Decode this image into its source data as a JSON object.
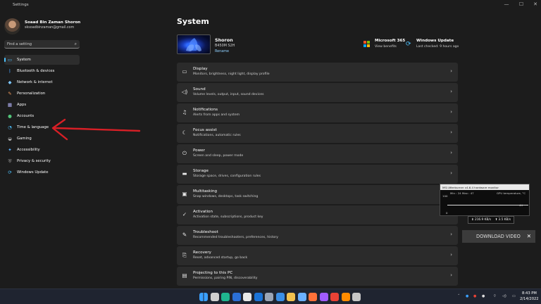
{
  "window": {
    "title": "Settings",
    "controls": {
      "minimize": "—",
      "maximize": "☐",
      "close": "✕"
    }
  },
  "user": {
    "name": "Soaad Bin Zaman Shoron",
    "email": "sksoadbinzaman@gmail.com"
  },
  "search": {
    "placeholder": "Find a setting",
    "icon": "search-icon"
  },
  "sidebar": {
    "items": [
      {
        "label": "System",
        "icon": "system-icon",
        "color": "#4cc2ff",
        "active": true
      },
      {
        "label": "Bluetooth & devices",
        "icon": "bluetooth-icon",
        "color": "#4aa3ff"
      },
      {
        "label": "Network & internet",
        "icon": "wifi-icon",
        "color": "#7ec8ff"
      },
      {
        "label": "Personalization",
        "icon": "brush-icon",
        "color": "#f29b5c"
      },
      {
        "label": "Apps",
        "icon": "apps-icon",
        "color": "#b8b8ff"
      },
      {
        "label": "Accounts",
        "icon": "accounts-icon",
        "color": "#52c47a"
      },
      {
        "label": "Time & language",
        "icon": "time-language-icon",
        "color": "#4cc2ff"
      },
      {
        "label": "Gaming",
        "icon": "gaming-icon",
        "color": "#b0b0b0"
      },
      {
        "label": "Accessibility",
        "icon": "accessibility-icon",
        "color": "#5ab0ff"
      },
      {
        "label": "Privacy & security",
        "icon": "shield-icon",
        "color": "#a0a0a0"
      },
      {
        "label": "Windows Update",
        "icon": "windows-update-icon",
        "color": "#4cc2ff"
      }
    ]
  },
  "main": {
    "title": "System",
    "device": {
      "name": "Shoron",
      "model": "B450M S2H",
      "rename": "Rename"
    },
    "microsoft365": {
      "title": "Microsoft 365",
      "subtitle": "View benefits",
      "logo_colors": [
        "#f35325",
        "#81bc06",
        "#05a6f0",
        "#ffba08"
      ]
    },
    "windows_update": {
      "title": "Windows Update",
      "subtitle": "Last checked: 9 hours ago"
    },
    "settings": [
      {
        "title": "Display",
        "subtitle": "Monitors, brightness, night light, display profile",
        "icon": "display-icon"
      },
      {
        "title": "Sound",
        "subtitle": "Volume levels, output, input, sound devices",
        "icon": "speaker-icon"
      },
      {
        "title": "Notifications",
        "subtitle": "Alerts from apps and system",
        "icon": "bell-icon"
      },
      {
        "title": "Focus assist",
        "subtitle": "Notifications, automatic rules",
        "icon": "moon-icon"
      },
      {
        "title": "Power",
        "subtitle": "Screen and sleep, power mode",
        "icon": "power-icon"
      },
      {
        "title": "Storage",
        "subtitle": "Storage space, drives, configuration rules",
        "icon": "storage-icon"
      },
      {
        "title": "Multitasking",
        "subtitle": "Snap windows, desktops, task switching",
        "icon": "multitasking-icon"
      },
      {
        "title": "Activation",
        "subtitle": "Activation state, subscriptions, product key",
        "icon": "checkmark-circle-icon"
      },
      {
        "title": "Troubleshoot",
        "subtitle": "Recommended troubleshooters, preferences, history",
        "icon": "wrench-icon"
      },
      {
        "title": "Recovery",
        "subtitle": "Reset, advanced startup, go back",
        "icon": "recovery-icon"
      },
      {
        "title": "Projecting to this PC",
        "subtitle": "Permissions, pairing PIN, discoverability",
        "icon": "projector-icon"
      }
    ]
  },
  "overlay": {
    "afterburner_title": "MSI Afterburner v4.6.4 hardware monitor",
    "stats": "Min : 24  Max : 47",
    "gpu_label": "GPU temperature, °C",
    "tick_top": "100",
    "tick_bottom": "0",
    "current_value": "44",
    "net_down": "⬇ 216.9 KB/s",
    "net_up": "⬆ 3.5 KB/s",
    "download_video": "DOWNLOAD VIDEO",
    "download_close": "✕"
  },
  "taskbar": {
    "icons": [
      {
        "name": "start-icon",
        "color": "#3aa0ff"
      },
      {
        "name": "search-taskbar-icon",
        "color": "#d0d0d0"
      },
      {
        "name": "edge-icon",
        "color": "#1fb58f"
      },
      {
        "name": "word-icon",
        "color": "#2b6fd6"
      },
      {
        "name": "calendar-icon",
        "color": "#e8e8e8"
      },
      {
        "name": "outlook-icon",
        "color": "#1a73d8"
      },
      {
        "name": "settings-icon",
        "color": "#9aa4b5"
      },
      {
        "name": "store-icon",
        "color": "#3a8ee6"
      },
      {
        "name": "file-explorer-icon",
        "color": "#f2c14e"
      },
      {
        "name": "photos-icon",
        "color": "#6ab0ff"
      },
      {
        "name": "firefox-icon",
        "color": "#ff7139"
      },
      {
        "name": "messenger-icon",
        "color": "#a05cff"
      },
      {
        "name": "chrome-icon",
        "color": "#e94235"
      },
      {
        "name": "vlc-icon",
        "color": "#ff8c00"
      },
      {
        "name": "app-icon",
        "color": "#c7c7c7"
      }
    ],
    "time": "8:43 PM",
    "date": "2/14/2022"
  }
}
